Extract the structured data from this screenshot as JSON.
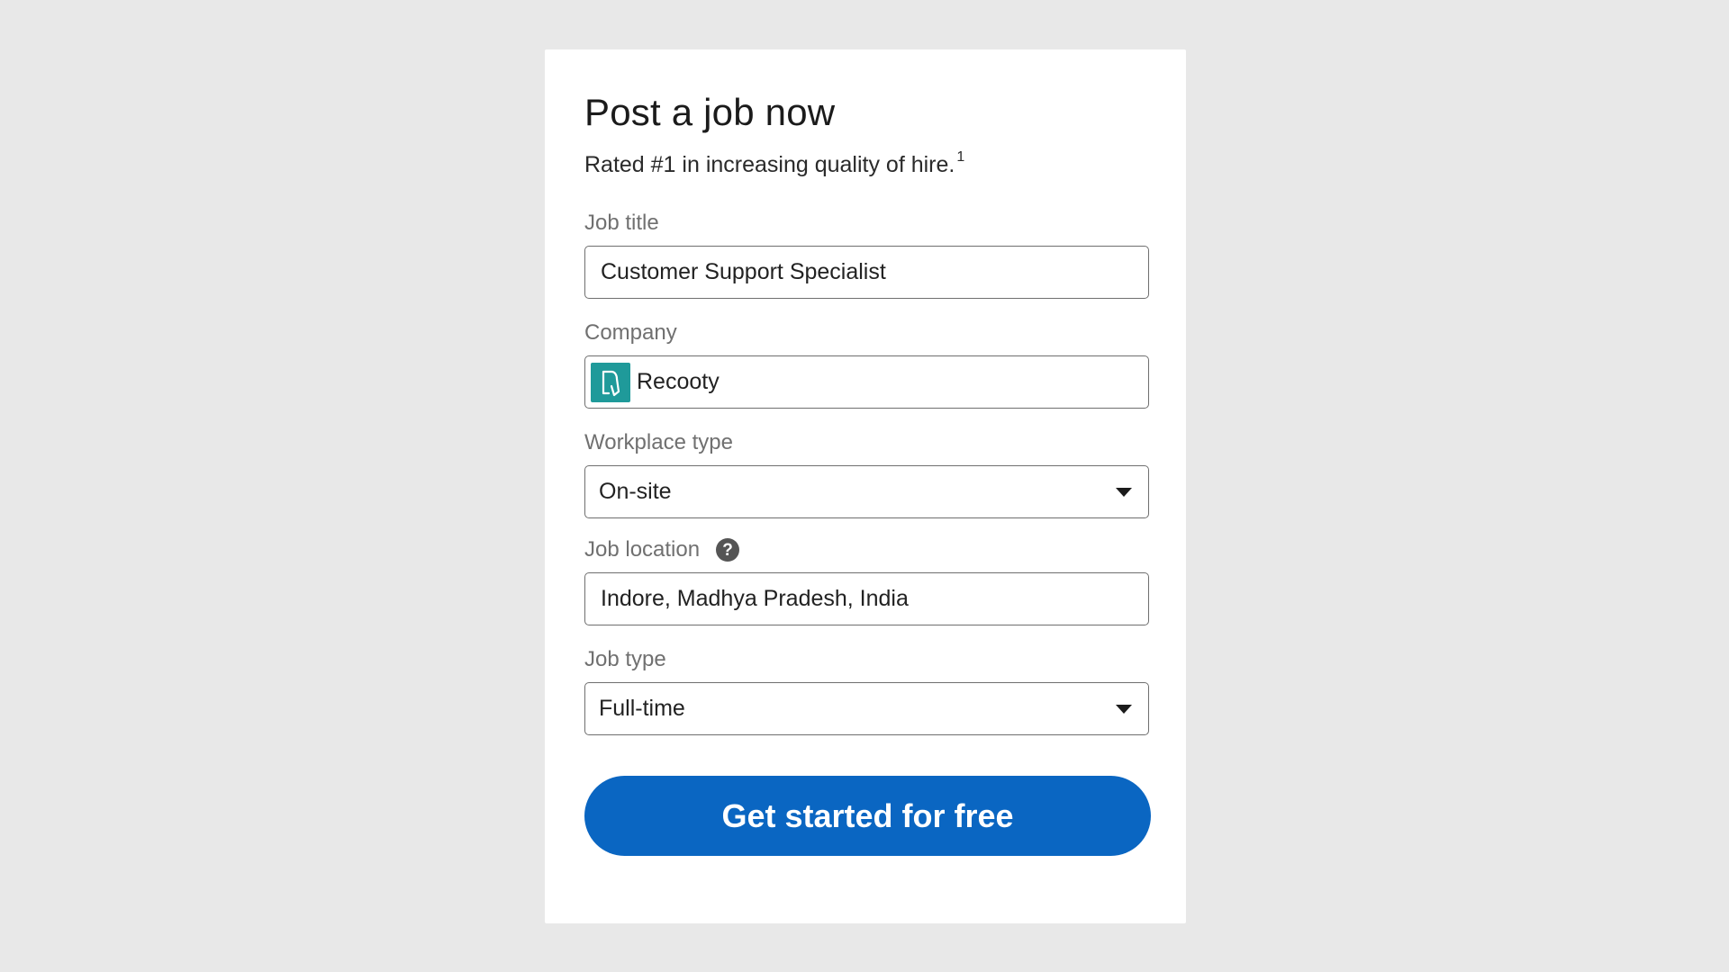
{
  "form": {
    "title": "Post a job now",
    "subtitle": "Rated #1 in increasing quality of hire.",
    "footnote": "1",
    "fields": {
      "job_title": {
        "label": "Job title",
        "value": "Customer Support Specialist"
      },
      "company": {
        "label": "Company",
        "value": "Recooty",
        "logo_icon": "company-logo-icon"
      },
      "workplace_type": {
        "label": "Workplace type",
        "value": "On-site"
      },
      "job_location": {
        "label": "Job location",
        "value": "Indore, Madhya Pradesh, India",
        "help_icon": "question-circle-icon"
      },
      "job_type": {
        "label": "Job type",
        "value": "Full-time"
      }
    },
    "cta_label": "Get started for free"
  },
  "colors": {
    "background": "#e8e8e8",
    "card": "#ffffff",
    "primary": "#0a66c2",
    "logo": "#1f9a9a"
  }
}
